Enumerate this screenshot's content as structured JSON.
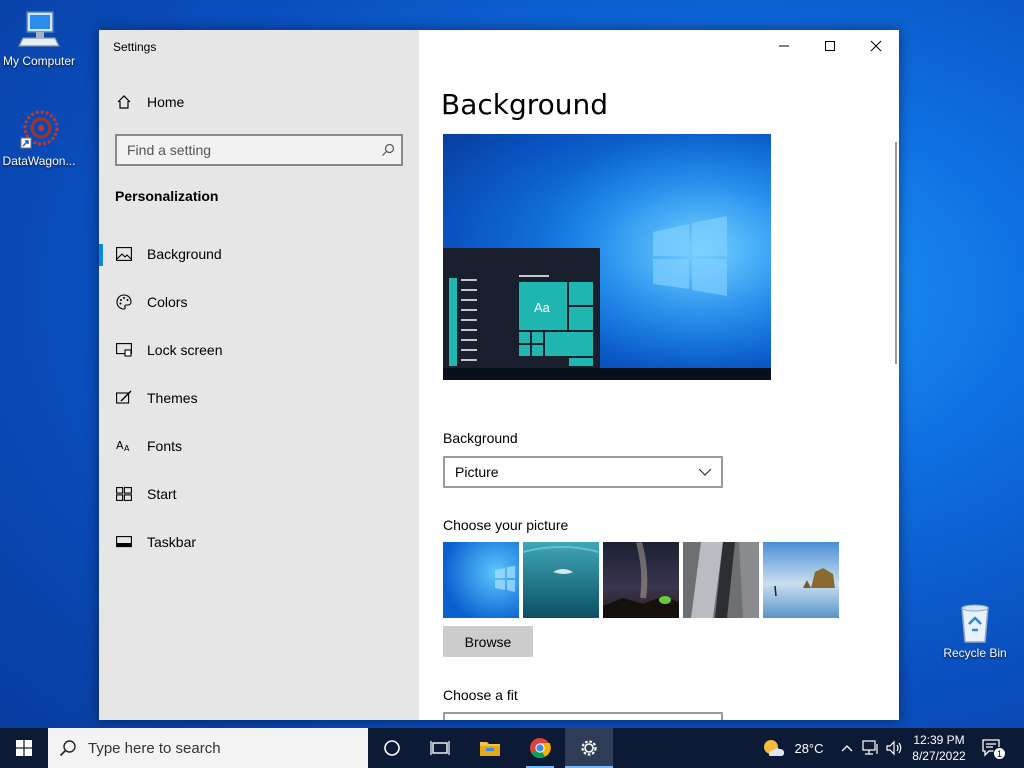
{
  "desktop": {
    "icons": [
      {
        "label": "My Computer",
        "icon": "computer-icon"
      },
      {
        "label": "DataWagon...",
        "icon": "datawagon-shortcut-icon"
      },
      {
        "label": "Recycle Bin",
        "icon": "recycle-bin-icon"
      }
    ]
  },
  "window": {
    "title": "Settings",
    "controls": {
      "minimize": "minimize-icon",
      "maximize": "maximize-icon",
      "close": "close-icon"
    }
  },
  "sidebar": {
    "home_label": "Home",
    "search_placeholder": "Find a setting",
    "section_title": "Personalization",
    "items": [
      {
        "label": "Background",
        "icon": "picture-icon",
        "active": true
      },
      {
        "label": "Colors",
        "icon": "palette-icon",
        "active": false
      },
      {
        "label": "Lock screen",
        "icon": "lock-screen-icon",
        "active": false
      },
      {
        "label": "Themes",
        "icon": "themes-icon",
        "active": false
      },
      {
        "label": "Fonts",
        "icon": "fonts-icon",
        "active": false
      },
      {
        "label": "Start",
        "icon": "start-icon",
        "active": false
      },
      {
        "label": "Taskbar",
        "icon": "taskbar-icon",
        "active": false
      }
    ]
  },
  "main": {
    "title": "Background",
    "preview_tile_text": "Aa",
    "background_label": "Background",
    "background_value": "Picture",
    "choose_picture_label": "Choose your picture",
    "browse_label": "Browse",
    "choose_fit_label": "Choose a fit"
  },
  "taskbar": {
    "search_placeholder": "Type here to search",
    "weather_temp": "28°C",
    "time": "12:39 PM",
    "date": "8/27/2022",
    "notification_count": "1"
  },
  "colors": {
    "accent": "#0a8ad6",
    "tile": "#1fb5b0",
    "taskbar": "#0c1a36",
    "sidebar": "#e6e6e6"
  }
}
